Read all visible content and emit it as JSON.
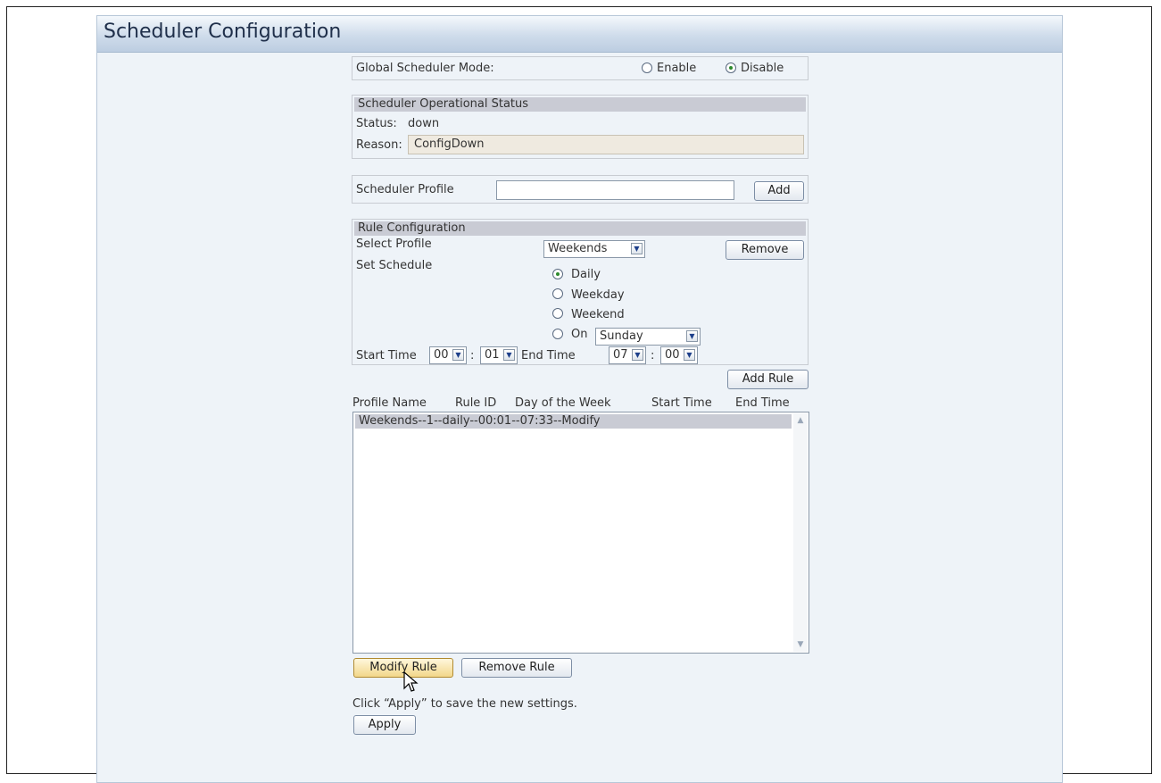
{
  "page": {
    "title": "Scheduler Configuration"
  },
  "global_mode": {
    "label": "Global Scheduler Mode:",
    "options": [
      "Enable",
      "Disable"
    ],
    "selected": "Disable"
  },
  "status_section": {
    "heading": "Scheduler Operational Status",
    "status_label": "Status:",
    "status_value": "down",
    "reason_label": "Reason:",
    "reason_value": "ConfigDown"
  },
  "profile_section": {
    "label": "Scheduler Profile",
    "input_value": "",
    "add_label": "Add"
  },
  "rule_section": {
    "heading": "Rule Configuration",
    "select_profile_label": "Select Profile",
    "select_profile_value": "Weekends",
    "remove_label": "Remove",
    "set_schedule_label": "Set Schedule",
    "schedule_options": [
      "Daily",
      "Weekday",
      "Weekend",
      "On"
    ],
    "schedule_selected": "Daily",
    "on_day_value": "Sunday",
    "start_time_label": "Start Time",
    "start_hour": "00",
    "start_min": "01",
    "time_sep": ":",
    "end_time_label": "End Time",
    "end_hour": "07",
    "end_min": "00",
    "add_rule_label": "Add Rule"
  },
  "rules_table": {
    "columns": [
      "Profile Name",
      "Rule ID",
      "Day of the Week",
      "Start Time",
      "End Time"
    ],
    "rows": [
      "Weekends--1--daily--00:01--07:33--Modify"
    ]
  },
  "actions": {
    "modify_rule_label": "Modify Rule",
    "remove_rule_label": "Remove Rule",
    "apply_hint": "Click “Apply” to save the new settings.",
    "apply_label": "Apply"
  },
  "icons": {
    "dropdown": "chevron-down-icon",
    "scroll_up": "scroll-up-icon",
    "scroll_down": "scroll-down-icon",
    "cursor": "mouse-pointer-icon"
  },
  "colors": {
    "header_text": "#1f2f4a",
    "band": "#c9cbd4",
    "radio_dot": "#2d8a2d",
    "hot_button": "#f2d78a"
  }
}
